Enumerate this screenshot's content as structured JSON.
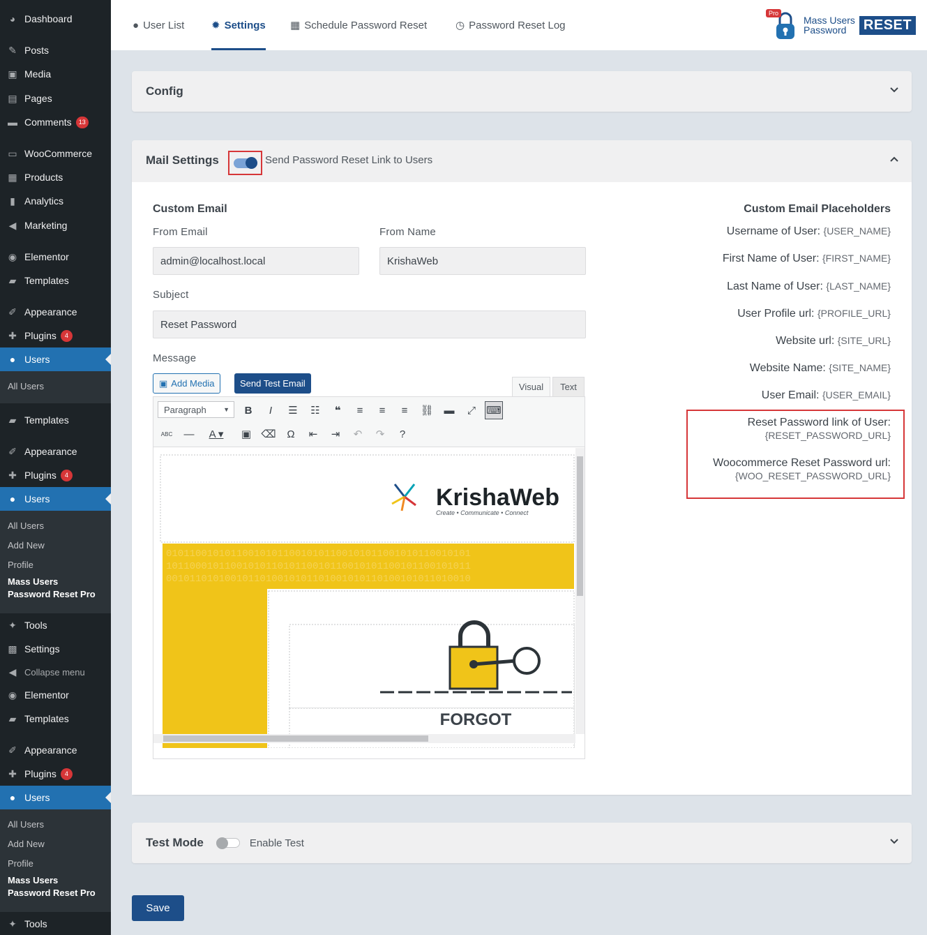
{
  "sidebar": {
    "items": [
      {
        "label": "Dashboard",
        "icon": "dashboard-icon"
      },
      {
        "label": "Posts",
        "icon": "pin-icon"
      },
      {
        "label": "Media",
        "icon": "media-icon"
      },
      {
        "label": "Pages",
        "icon": "pages-icon"
      },
      {
        "label": "Comments",
        "icon": "comment-icon",
        "badge": "13"
      },
      {
        "label": "WooCommerce",
        "icon": "woo-icon"
      },
      {
        "label": "Products",
        "icon": "archive-icon"
      },
      {
        "label": "Analytics",
        "icon": "bar-chart-icon"
      },
      {
        "label": "Marketing",
        "icon": "megaphone-icon"
      },
      {
        "label": "Elementor",
        "icon": "elementor-icon"
      },
      {
        "label": "Templates",
        "icon": "folder-icon"
      },
      {
        "label": "Appearance",
        "icon": "brush-icon"
      },
      {
        "label": "Plugins",
        "icon": "plugin-icon",
        "badge": "4"
      },
      {
        "label": "Users",
        "icon": "user-icon"
      }
    ],
    "sub_partial": "All Users",
    "group2": {
      "templates": "Templates",
      "appearance": "Appearance",
      "plugins": "Plugins",
      "plugins_badge": "4",
      "users": "Users",
      "sub": [
        "All Users",
        "Add New",
        "Profile"
      ],
      "sub_current": "Mass Users Password Reset Pro",
      "tools": "Tools",
      "settings": "Settings",
      "collapse": "Collapse menu"
    },
    "group3": {
      "elementor": "Elementor",
      "templates": "Templates",
      "appearance": "Appearance",
      "plugins": "Plugins",
      "plugins_badge": "4",
      "users": "Users",
      "sub": [
        "All Users",
        "Add New",
        "Profile"
      ],
      "sub_current": "Mass Users Password Reset Pro",
      "tools": "Tools"
    }
  },
  "tabs": [
    {
      "label": "User List",
      "icon": "user-icon"
    },
    {
      "label": "Settings",
      "icon": "gear-icon"
    },
    {
      "label": "Schedule Password Reset",
      "icon": "calendar-icon"
    },
    {
      "label": "Password Reset Log",
      "icon": "clock-icon"
    }
  ],
  "logo": {
    "pro": "Pro",
    "line1": "Mass Users",
    "line2": "Password",
    "reset": "RESET"
  },
  "config": {
    "title": "Config"
  },
  "mail": {
    "title": "Mail Settings",
    "toggle_label": "Send Password Reset Link to Users",
    "toggle_on": true,
    "custom_email_title": "Custom Email",
    "from_email_label": "From Email",
    "from_email_value": "admin@localhost.local",
    "from_name_label": "From Name",
    "from_name_value": "KrishaWeb",
    "subject_label": "Subject",
    "subject_value": "Reset Password",
    "message_label": "Message",
    "add_media": "Add Media",
    "send_test": "Send Test Email",
    "tab_visual": "Visual",
    "tab_text": "Text",
    "paragraph": "Paragraph",
    "email_preview": {
      "brand": "KrishaWeb",
      "tagline": "Create • Communicate • Connect",
      "heading": "FORGOT"
    }
  },
  "placeholders": {
    "title": "Custom Email Placeholders",
    "rows": [
      {
        "label": "Username of User:",
        "code": "{USER_NAME}"
      },
      {
        "label": "First Name of User:",
        "code": "{FIRST_NAME}"
      },
      {
        "label": "Last Name of User:",
        "code": "{LAST_NAME}"
      },
      {
        "label": "User Profile url:",
        "code": "{PROFILE_URL}"
      },
      {
        "label": "Website url:",
        "code": "{SITE_URL}"
      },
      {
        "label": "Website Name:",
        "code": "{SITE_NAME}"
      },
      {
        "label": "User Email:",
        "code": "{USER_EMAIL}"
      }
    ],
    "reset_label": "Reset Password link of User:",
    "reset_code": "{RESET_PASSWORD_URL}",
    "woo_label": "Woocommerce Reset Password url:",
    "woo_code": "{WOO_RESET_PASSWORD_URL}"
  },
  "test_mode": {
    "title": "Test Mode",
    "toggle_label": "Enable Test",
    "toggle_on": false
  },
  "save_label": "Save",
  "colors": {
    "primary": "#1d4e89",
    "wp_sidebar": "#1d23277",
    "highlight": "#d63638",
    "yellow": "#f0c419"
  }
}
